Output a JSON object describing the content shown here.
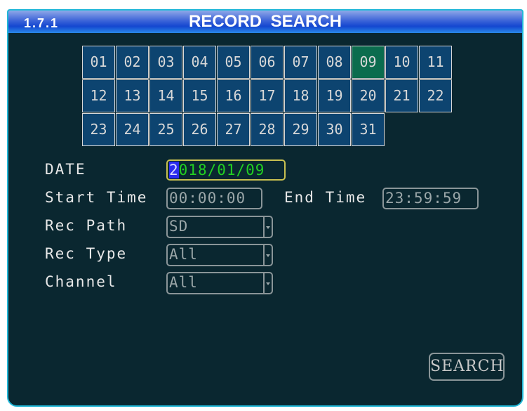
{
  "header": {
    "menu_number": "1.7.1",
    "title": "RECORD SEARCH"
  },
  "calendar": {
    "days": [
      "01",
      "02",
      "03",
      "04",
      "05",
      "06",
      "07",
      "08",
      "09",
      "10",
      "11",
      "12",
      "13",
      "14",
      "15",
      "16",
      "17",
      "18",
      "19",
      "20",
      "21",
      "22",
      "23",
      "24",
      "25",
      "26",
      "27",
      "28",
      "29",
      "30",
      "31"
    ],
    "selected": "09",
    "selected_color": "#0b6c4e",
    "cell_color": "#0d4470"
  },
  "form": {
    "date_label": "DATE",
    "date_cursor": "2",
    "date_rest": "018/01/09",
    "start_label": "Start Time",
    "start_value": "00:00:00",
    "end_label": "End Time",
    "end_value": "23:59:59",
    "path_label": "Rec Path",
    "path_value": "SD",
    "type_label": "Rec Type",
    "type_value": "All",
    "channel_label": "Channel",
    "channel_value": "All"
  },
  "search_label": "SEARCH"
}
